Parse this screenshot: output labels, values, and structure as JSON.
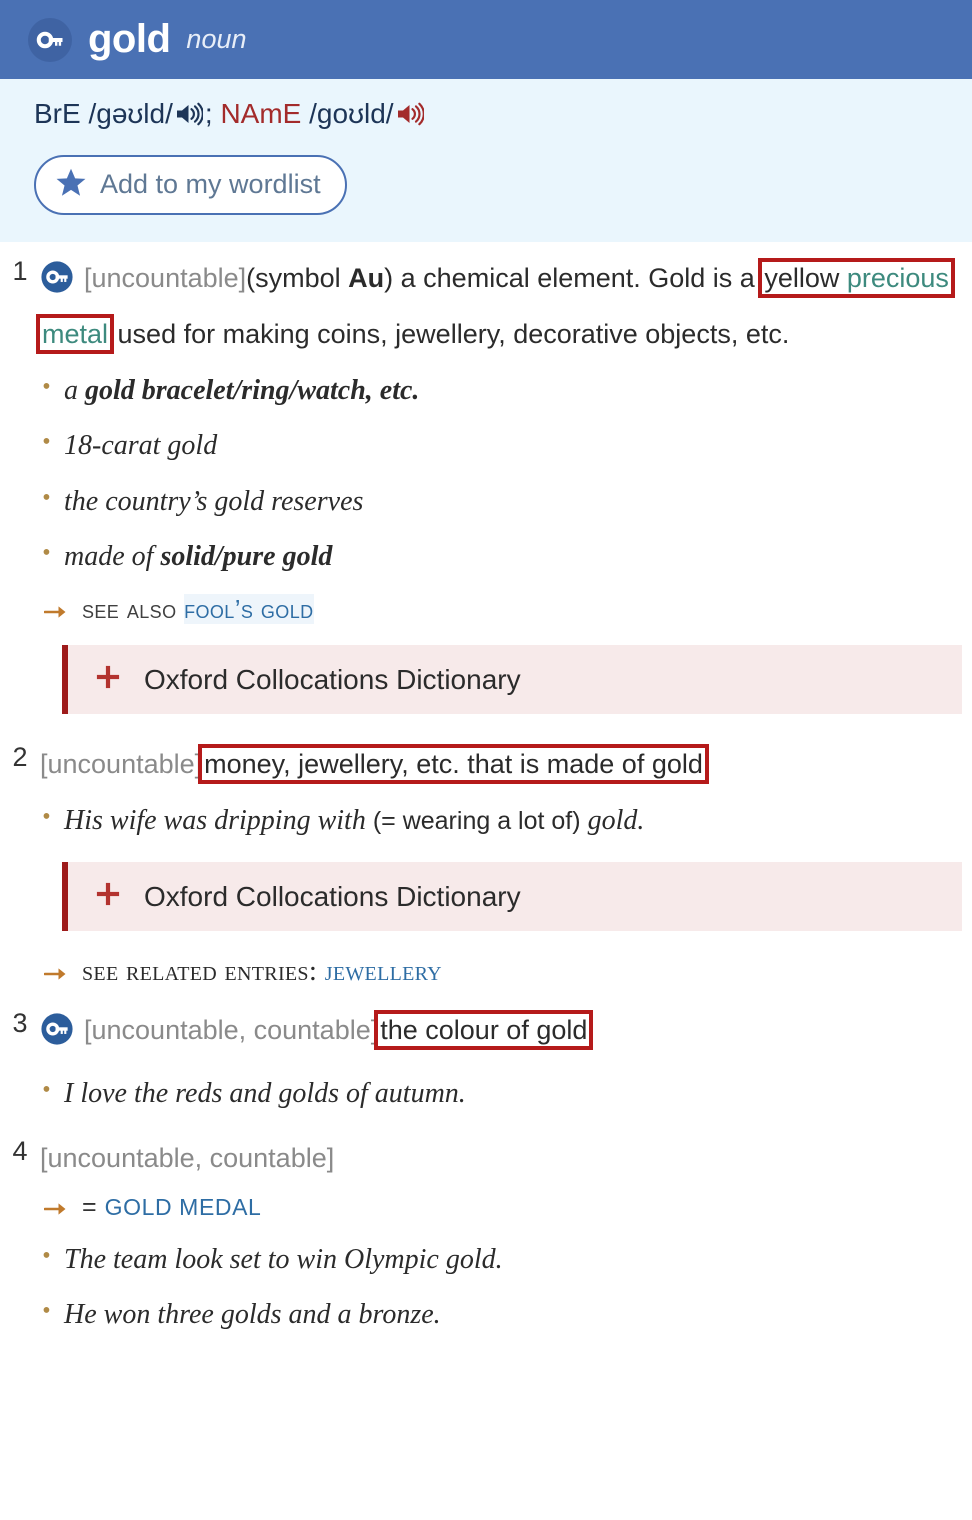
{
  "header": {
    "key_icon": "key-icon",
    "headword": "gold",
    "part_of_speech": "noun"
  },
  "pronunciation": {
    "bre_label": "BrE",
    "bre_phonetic": "/ɡəʊld/",
    "separator": ";",
    "name_label": "NAmE",
    "name_phonetic": "/ɡoʊld/",
    "bre_speaker_icon": "speaker-icon",
    "name_speaker_icon": "speaker-icon"
  },
  "wordlist_button": {
    "icon": "star-icon",
    "label": "Add to my wordlist"
  },
  "colors": {
    "header_bg": "#4a71b4",
    "pron_bg": "#eaf6fd",
    "highlight_box": "#b51a1a",
    "link_teal": "#3d8a7e",
    "link_blue": "#2e6da4",
    "arrow_orange": "#c07a2c",
    "colloc_bg": "#f7eaea",
    "colloc_border": "#9e1b1b",
    "name_label": "#a32b2b"
  },
  "senses": [
    {
      "number": "1",
      "has_key_icon": true,
      "grammar": "[uncountable]",
      "def_pre": "(symbol ",
      "def_symbol": "Au",
      "def_mid": ") a chemical element. Gold is a ",
      "hl_pre": "yellow ",
      "hl_link": "precious metal",
      "def_post": " used for making coins, jewellery, decorative objects, etc.",
      "examples": [
        {
          "pre": "a ",
          "bold": "gold bracelet/ring/watch, etc.",
          "post": ""
        },
        {
          "pre": "18-carat gold",
          "bold": "",
          "post": ""
        },
        {
          "pre": "the country’s gold reserves",
          "bold": "",
          "post": ""
        },
        {
          "pre": "made of ",
          "bold": "solid/pure gold",
          "post": ""
        }
      ],
      "see_also": {
        "label": "see also",
        "link": "fool’s gold"
      },
      "collocations": {
        "plus": "+",
        "label": "Oxford Collocations Dictionary"
      }
    },
    {
      "number": "2",
      "has_key_icon": false,
      "grammar": "[uncountable]",
      "definition": "money, jewellery, etc. that is made of gold",
      "examples": [
        {
          "pre": "His wife was dripping with ",
          "gloss": "(= wearing a lot of)",
          "post": " gold."
        }
      ],
      "collocations": {
        "plus": "+",
        "label": "Oxford Collocations Dictionary"
      },
      "related": {
        "label": "See related entries:",
        "link": "Jewellery"
      }
    },
    {
      "number": "3",
      "has_key_icon": true,
      "grammar": "[uncountable, countable]",
      "definition": "the colour of gold",
      "examples": [
        {
          "pre": "I love the reds and golds of autumn.",
          "bold": "",
          "post": ""
        }
      ]
    },
    {
      "number": "4",
      "has_key_icon": false,
      "grammar": "[uncountable, countable]",
      "equals": {
        "eq": "=",
        "link": "GOLD MEDAL"
      },
      "examples": [
        {
          "pre": "The team look set to win Olympic gold.",
          "bold": "",
          "post": ""
        },
        {
          "pre": "He won three golds and a bronze.",
          "bold": "",
          "post": ""
        }
      ]
    }
  ]
}
